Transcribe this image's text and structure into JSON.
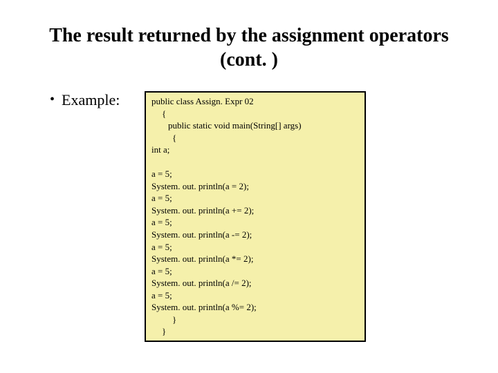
{
  "title": "The result returned by the assignment operators (cont. )",
  "bullet_label": "Example:",
  "code": {
    "decl": "public class Assign. Expr 02",
    "obrace": "{",
    "main": "public static void main(String[] args)",
    "obrace2": "{",
    "vardecl": "int a;",
    "blank": "",
    "l1": "a = 5;",
    "l2": "System. out. println(a = 2);",
    "l3": "a = 5;",
    "l4": "System. out. println(a += 2);",
    "l5": "a = 5;",
    "l6": "System. out. println(a -= 2);",
    "l7": "a = 5;",
    "l8": "System. out. println(a *= 2);",
    "l9": "a = 5;",
    "l10": "System. out. println(a /= 2);",
    "l11": "a = 5;",
    "l12": "System. out. println(a %= 2);",
    "cbrace2": "}",
    "cbrace": "}"
  }
}
